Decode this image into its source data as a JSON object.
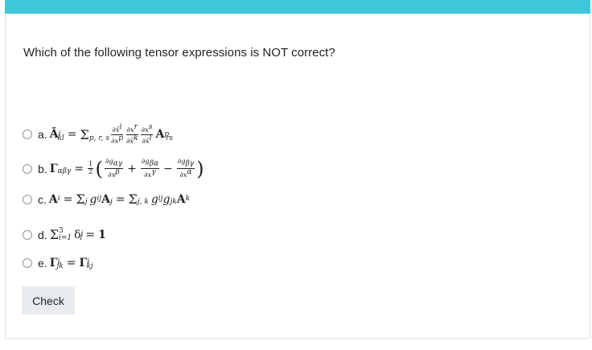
{
  "theme": {
    "accent": "#3fc6da"
  },
  "question": {
    "text": "Which of the following tensor expressions is NOT correct?"
  },
  "answers": [
    {
      "letter": "a."
    },
    {
      "letter": "b."
    },
    {
      "letter": "c."
    },
    {
      "letter": "d."
    },
    {
      "letter": "e."
    }
  ],
  "check": {
    "label": "Check"
  }
}
